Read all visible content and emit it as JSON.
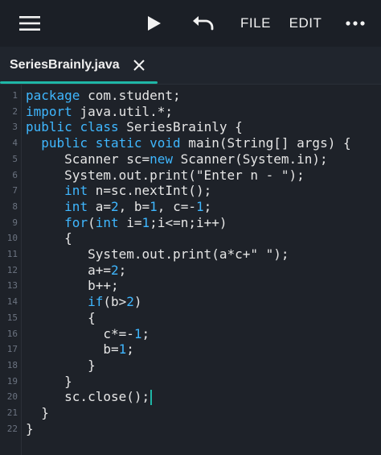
{
  "toolbar": {
    "file_label": "FILE",
    "edit_label": "EDIT"
  },
  "tab": {
    "label": "SeriesBrainly.java"
  },
  "editor": {
    "lines": [
      {
        "n": "1",
        "t": "package com.student;"
      },
      {
        "n": "2",
        "t": "import java.util.*;"
      },
      {
        "n": "3",
        "t": "public class SeriesBrainly {"
      },
      {
        "n": "4",
        "t": "  public static void main(String[] args) {"
      },
      {
        "n": "5",
        "t": "     Scanner sc=new Scanner(System.in);"
      },
      {
        "n": "6",
        "t": "     System.out.print(\"Enter n - \");"
      },
      {
        "n": "7",
        "t": "     int n=sc.nextInt();"
      },
      {
        "n": "8",
        "t": "     int a=2, b=1, c=-1;"
      },
      {
        "n": "9",
        "t": "     for(int i=1;i<=n;i++)"
      },
      {
        "n": "10",
        "t": "     {"
      },
      {
        "n": "11",
        "t": "        System.out.print(a*c+\" \");"
      },
      {
        "n": "12",
        "t": "        a+=2;"
      },
      {
        "n": "13",
        "t": "        b++;"
      },
      {
        "n": "14",
        "t": "        if(b>2)"
      },
      {
        "n": "15",
        "t": "        {"
      },
      {
        "n": "16",
        "t": "          c*=-1;"
      },
      {
        "n": "17",
        "t": "          b=1;"
      },
      {
        "n": "18",
        "t": "        }"
      },
      {
        "n": "19",
        "t": "     }"
      },
      {
        "n": "20",
        "t": "     sc.close();"
      },
      {
        "n": "21",
        "t": "  }"
      },
      {
        "n": "22",
        "t": "}"
      }
    ]
  },
  "icons": {
    "menu": "hamburger-menu-icon",
    "run": "play-icon",
    "undo": "undo-icon",
    "more": "more-horizontal-icon",
    "close": "close-icon"
  },
  "colors": {
    "background": "#1e2229",
    "accent": "#1fb6a6",
    "keyword": "#3fb7ff"
  }
}
